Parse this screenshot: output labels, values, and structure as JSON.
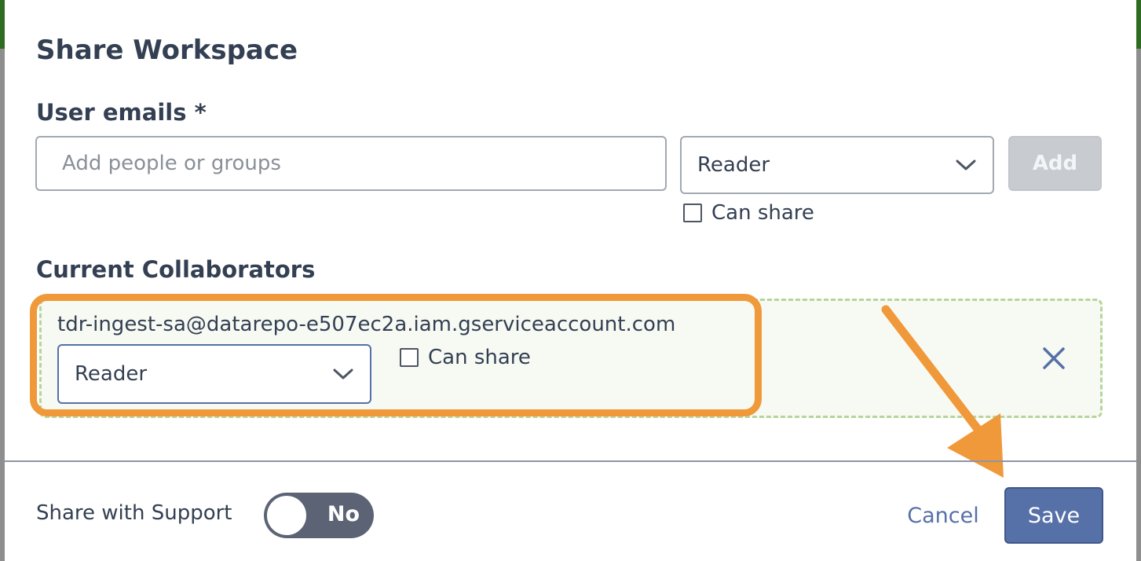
{
  "dialog": {
    "title": "Share Workspace",
    "emails_label": "User emails *",
    "email_input": {
      "value": "",
      "placeholder": "Add people or groups"
    },
    "role_select": {
      "selected": "Reader",
      "icon": "chevron-down-icon"
    },
    "add_button": "Add",
    "can_share_label": "Can share",
    "can_share_checked": false
  },
  "collaborators": {
    "heading": "Current Collaborators",
    "items": [
      {
        "email": "tdr-ingest-sa@datarepo-e507ec2a.iam.gserviceaccount.com",
        "role": "Reader",
        "can_share_label": "Can share",
        "can_share_checked": false,
        "remove_icon": "close-icon"
      }
    ]
  },
  "footer": {
    "support_label": "Share with Support",
    "support_toggle": {
      "state_label": "No",
      "on": false
    },
    "cancel_button": "Cancel",
    "save_button": "Save"
  },
  "colors": {
    "text": "#333f52",
    "primary": "#5670a8",
    "highlight": "#f0993a",
    "collab_border": "#b7d59b",
    "disabled_button": "#c8cbd0",
    "toggle_track": "#5b6375"
  }
}
